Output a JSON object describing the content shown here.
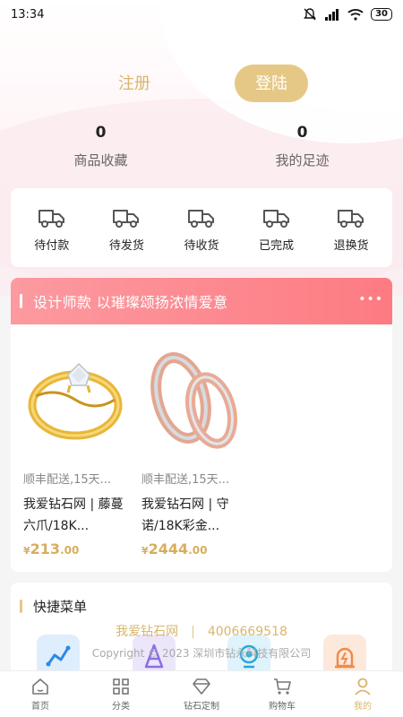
{
  "status_bar": {
    "time": "13:34",
    "battery": "30"
  },
  "auth": {
    "register_label": "注册",
    "login_label": "登陆"
  },
  "stats": [
    {
      "count": "0",
      "label": "商品收藏"
    },
    {
      "count": "0",
      "label": "我的足迹"
    }
  ],
  "orders": [
    {
      "label": "待付款"
    },
    {
      "label": "待发货"
    },
    {
      "label": "待收货"
    },
    {
      "label": "已完成"
    },
    {
      "label": "退换货"
    }
  ],
  "designer": {
    "title": "设计师款  以璀璨颂扬浓情爱意",
    "more": "•••",
    "products": [
      {
        "shipping": "顺丰配送,15天...",
        "name": "我爱钻石网 | 藤蔓六爪/18K...",
        "price_symbol": "¥",
        "price_int": "213",
        "price_dec": ".00"
      },
      {
        "shipping": "顺丰配送,15天...",
        "name": "我爱钻石网 | 守诺/18K彩金...",
        "price_symbol": "¥",
        "price_int": "2444",
        "price_dec": ".00"
      }
    ]
  },
  "quick_menu": {
    "title": "快捷菜单"
  },
  "footer": {
    "brand": "我爱钻石网",
    "separator": "|",
    "phone": "4006669518",
    "copyright": "Copyright © 2023 深圳市钻永科技有限公司"
  },
  "tabbar": [
    {
      "label": "首页",
      "icon": "home-icon"
    },
    {
      "label": "分类",
      "icon": "category-icon"
    },
    {
      "label": "钻石定制",
      "icon": "diamond-icon"
    },
    {
      "label": "购物车",
      "icon": "cart-icon"
    },
    {
      "label": "我的",
      "icon": "user-icon",
      "active": true
    }
  ],
  "colors": {
    "accent_gold": "#e6c886",
    "banner_pink": "#fd7b82"
  }
}
